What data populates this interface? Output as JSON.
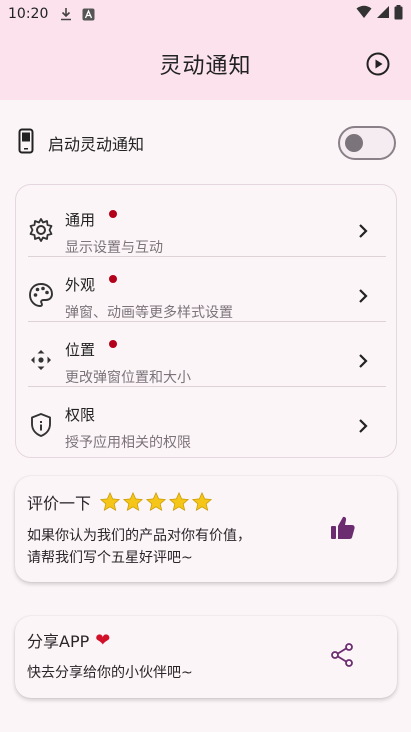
{
  "status_bar": {
    "time": "10:20"
  },
  "app_bar": {
    "title": "灵动通知"
  },
  "toggle": {
    "label": "启动灵动通知",
    "enabled": false
  },
  "settings": {
    "items": [
      {
        "title": "通用",
        "subtitle": "显示设置与互动",
        "has_dot": true,
        "icon": "gear-icon"
      },
      {
        "title": "外观",
        "subtitle": "弹窗、动画等更多样式设置",
        "has_dot": true,
        "icon": "palette-icon"
      },
      {
        "title": "位置",
        "subtitle": "更改弹窗位置和大小",
        "has_dot": true,
        "icon": "move-icon"
      },
      {
        "title": "权限",
        "subtitle": "授予应用相关的权限",
        "has_dot": false,
        "icon": "shield-icon"
      }
    ]
  },
  "rate": {
    "title": "评价一下",
    "stars": 5,
    "line1": "如果你认为我们的产品对你有价值，",
    "line2": "请帮我们写个五星好评吧~"
  },
  "share": {
    "title": "分享APP",
    "subtitle": "快去分享给你的小伙伴吧~"
  },
  "colors": {
    "accent": "#6b2d6f",
    "dot": "#b3001b",
    "star": "#f5c518",
    "heart": "#d2102a",
    "header_bg": "#fbe2ec"
  }
}
